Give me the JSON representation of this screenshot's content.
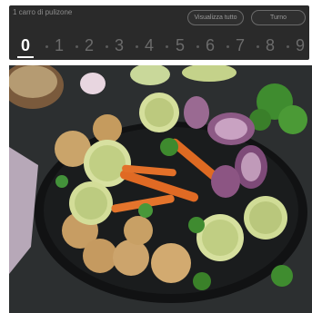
{
  "selector": {
    "hint_text": "1 carro di pulizone",
    "left_button": "Visualizza tutto",
    "right_button": "Turno",
    "digits": [
      "0",
      "1",
      "2",
      "3",
      "4",
      "5",
      "6",
      "7",
      "8",
      "9"
    ],
    "selected_index": 0
  },
  "photo": {
    "subject": "grilled-vegetables-plate"
  }
}
